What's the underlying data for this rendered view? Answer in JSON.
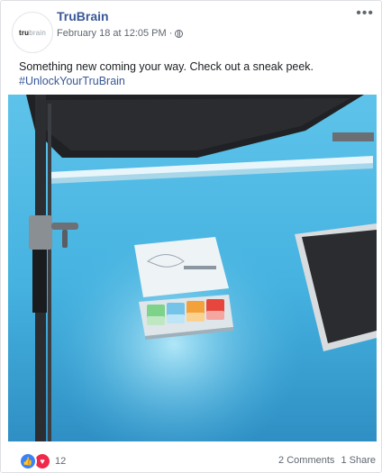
{
  "page": {
    "name": "TruBrain",
    "avatar_text_bold": "tru",
    "avatar_text_light": "brain",
    "timestamp": "February 18 at 12:05 PM",
    "separator": "·",
    "more_icon": "more-options-icon"
  },
  "post": {
    "text": "Something new coming your way. Check out a sneak peek.",
    "hashtag": "#UnlockYourTruBrain",
    "image_alt": "photo-studio-box"
  },
  "footer": {
    "reaction_count": "12",
    "comments": "2 Comments",
    "shares": "1 Share"
  },
  "colors": {
    "link": "#385898",
    "like": "#3b82f6",
    "love": "#f0284a",
    "backdrop": "#4bb6e0"
  }
}
